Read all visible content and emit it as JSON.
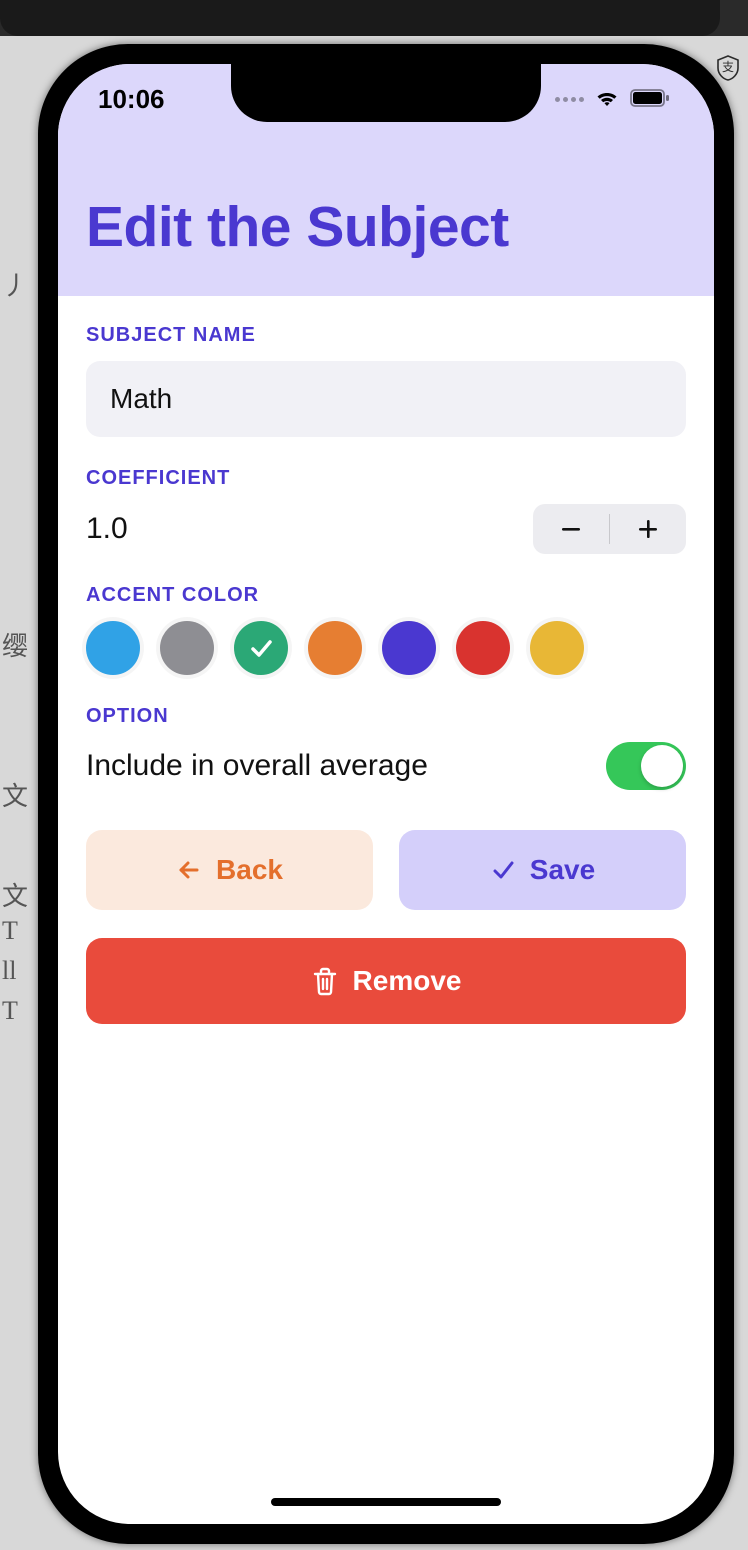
{
  "status": {
    "time": "10:06"
  },
  "header": {
    "title": "Edit the Subject"
  },
  "subject": {
    "label": "SUBJECT NAME",
    "value": "Math"
  },
  "coefficient": {
    "label": "COEFFICIENT",
    "value": "1.0"
  },
  "accent": {
    "label": "ACCENT COLOR",
    "colors": [
      "#30a2e6",
      "#8e8e93",
      "#2ba876",
      "#e67e32",
      "#4a38d0",
      "#d9332f",
      "#e8b736"
    ],
    "selected_index": 2
  },
  "option": {
    "label": "OPTION",
    "text": "Include in overall average",
    "enabled": true
  },
  "buttons": {
    "back": "Back",
    "save": "Save",
    "remove": "Remove"
  }
}
